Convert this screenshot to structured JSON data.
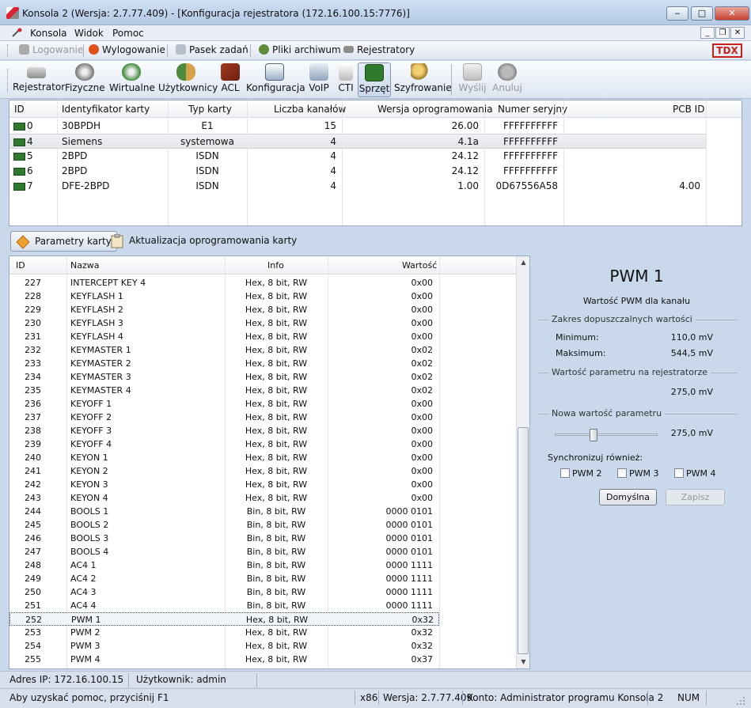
{
  "window": {
    "title": "Konsola 2 (Wersja:  2.7.77.409) - [Konfiguracja rejestratora (172.16.100.15:7776)]"
  },
  "menu": [
    "Konsola",
    "Widok",
    "Pomoc"
  ],
  "quickbar": {
    "login": "Logowanie",
    "logout": "Wylogowanie",
    "taskbar": "Pasek zadań",
    "archives": "Pliki archiwum",
    "recorders": "Rejestratory",
    "brand": "TDX"
  },
  "toolbar": [
    {
      "label": "Rejestrator",
      "icon": "recorder-icon"
    },
    {
      "label": "Fizyczne",
      "icon": "physical-channels-icon"
    },
    {
      "label": "Wirtualne",
      "icon": "virtual-channels-icon"
    },
    {
      "label": "Użytkownicy",
      "icon": "users-icon"
    },
    {
      "label": "ACL",
      "icon": "acl-icon"
    },
    {
      "label": "Konfiguracja",
      "icon": "configuration-icon"
    },
    {
      "label": "VoIP",
      "icon": "voip-icon"
    },
    {
      "label": "CTI",
      "icon": "cti-icon"
    },
    {
      "label": "Sprzęt",
      "icon": "hardware-icon"
    },
    {
      "label": "Szyfrowanie",
      "icon": "encryption-icon"
    },
    {
      "label": "Wyślij",
      "icon": "send-icon"
    },
    {
      "label": "Anuluj",
      "icon": "cancel-icon"
    }
  ],
  "cards": {
    "columns": [
      "ID",
      "Identyfikator karty",
      "Typ karty",
      "Liczba kanałów",
      "Wersja oprogramowania",
      "Numer seryjny",
      "PCB ID"
    ],
    "rows": [
      {
        "id": "0",
        "ident": "30BPDH",
        "type": "E1",
        "channels": "15",
        "version": "26.00",
        "serial": "FFFFFFFFFF",
        "pcb": ""
      },
      {
        "id": "4",
        "ident": "Siemens",
        "type": "systemowa",
        "channels": "4",
        "version": "4.1a",
        "serial": "FFFFFFFFFF",
        "pcb": ""
      },
      {
        "id": "5",
        "ident": "2BPD",
        "type": "ISDN",
        "channels": "4",
        "version": "24.12",
        "serial": "FFFFFFFFFF",
        "pcb": ""
      },
      {
        "id": "6",
        "ident": "2BPD",
        "type": "ISDN",
        "channels": "4",
        "version": "24.12",
        "serial": "FFFFFFFFFF",
        "pcb": ""
      },
      {
        "id": "7",
        "ident": "DFE-2BPD",
        "type": "ISDN",
        "channels": "4",
        "version": "1.00",
        "serial": "0D67556A58",
        "pcb": "4.00"
      }
    ]
  },
  "tabs": [
    "Parametry karty",
    "Aktualizacja oprogramowania karty"
  ],
  "params": {
    "columns": [
      "ID",
      "Nazwa",
      "Info",
      "Wartość"
    ],
    "rows": [
      {
        "id": "227",
        "name": "INTERCEPT KEY 4",
        "info": "Hex, 8 bit, RW",
        "value": "0x00"
      },
      {
        "id": "228",
        "name": "KEYFLASH 1",
        "info": "Hex, 8 bit, RW",
        "value": "0x00"
      },
      {
        "id": "229",
        "name": "KEYFLASH 2",
        "info": "Hex, 8 bit, RW",
        "value": "0x00"
      },
      {
        "id": "230",
        "name": "KEYFLASH 3",
        "info": "Hex, 8 bit, RW",
        "value": "0x00"
      },
      {
        "id": "231",
        "name": "KEYFLASH 4",
        "info": "Hex, 8 bit, RW",
        "value": "0x00"
      },
      {
        "id": "232",
        "name": "KEYMASTER 1",
        "info": "Hex, 8 bit, RW",
        "value": "0x02"
      },
      {
        "id": "233",
        "name": "KEYMASTER 2",
        "info": "Hex, 8 bit, RW",
        "value": "0x02"
      },
      {
        "id": "234",
        "name": "KEYMASTER 3",
        "info": "Hex, 8 bit, RW",
        "value": "0x02"
      },
      {
        "id": "235",
        "name": "KEYMASTER 4",
        "info": "Hex, 8 bit, RW",
        "value": "0x02"
      },
      {
        "id": "236",
        "name": "KEYOFF 1",
        "info": "Hex, 8 bit, RW",
        "value": "0x00"
      },
      {
        "id": "237",
        "name": "KEYOFF 2",
        "info": "Hex, 8 bit, RW",
        "value": "0x00"
      },
      {
        "id": "238",
        "name": "KEYOFF 3",
        "info": "Hex, 8 bit, RW",
        "value": "0x00"
      },
      {
        "id": "239",
        "name": "KEYOFF 4",
        "info": "Hex, 8 bit, RW",
        "value": "0x00"
      },
      {
        "id": "240",
        "name": "KEYON 1",
        "info": "Hex, 8 bit, RW",
        "value": "0x00"
      },
      {
        "id": "241",
        "name": "KEYON 2",
        "info": "Hex, 8 bit, RW",
        "value": "0x00"
      },
      {
        "id": "242",
        "name": "KEYON 3",
        "info": "Hex, 8 bit, RW",
        "value": "0x00"
      },
      {
        "id": "243",
        "name": "KEYON 4",
        "info": "Hex, 8 bit, RW",
        "value": "0x00"
      },
      {
        "id": "244",
        "name": "BOOLS 1",
        "info": "Bin, 8 bit, RW",
        "value": "0000 0101"
      },
      {
        "id": "245",
        "name": "BOOLS 2",
        "info": "Bin, 8 bit, RW",
        "value": "0000 0101"
      },
      {
        "id": "246",
        "name": "BOOLS 3",
        "info": "Bin, 8 bit, RW",
        "value": "0000 0101"
      },
      {
        "id": "247",
        "name": "BOOLS 4",
        "info": "Bin, 8 bit, RW",
        "value": "0000 0101"
      },
      {
        "id": "248",
        "name": "AC4 1",
        "info": "Bin, 8 bit, RW",
        "value": "0000 1111"
      },
      {
        "id": "249",
        "name": "AC4 2",
        "info": "Bin, 8 bit, RW",
        "value": "0000 1111"
      },
      {
        "id": "250",
        "name": "AC4 3",
        "info": "Bin, 8 bit, RW",
        "value": "0000 1111"
      },
      {
        "id": "251",
        "name": "AC4 4",
        "info": "Bin, 8 bit, RW",
        "value": "0000 1111"
      },
      {
        "id": "252",
        "name": "PWM 1",
        "info": "Hex, 8 bit, RW",
        "value": "0x32"
      },
      {
        "id": "253",
        "name": "PWM 2",
        "info": "Hex, 8 bit, RW",
        "value": "0x32"
      },
      {
        "id": "254",
        "name": "PWM 3",
        "info": "Hex, 8 bit, RW",
        "value": "0x32"
      },
      {
        "id": "255",
        "name": "PWM 4",
        "info": "Hex, 8 bit, RW",
        "value": "0x37"
      }
    ],
    "selected_id": "252"
  },
  "detail": {
    "title": "PWM 1",
    "subtitle": "Wartość PWM dla kanału",
    "range_group": "Zakres dopuszczalnych wartości",
    "min_label": "Minimum:",
    "min_value": "110,0 mV",
    "max_label": "Maksimum:",
    "max_value": "544,5 mV",
    "current_group": "Wartość parametru na rejestratorze",
    "current_value": "275,0 mV",
    "new_group": "Nowa wartość parametru",
    "new_value": "275,0 mV",
    "slider_fraction": 0.38,
    "sync_label": "Synchronizuj również:",
    "sync_options": [
      "PWM 2",
      "PWM 3",
      "PWM 4"
    ],
    "default_button": "Domyślna",
    "save_button": "Zapisz"
  },
  "status": {
    "ip": "Adres IP: 172.16.100.15",
    "user": "Użytkownik: admin",
    "help": "Aby uzyskać pomoc, przyciśnij F1",
    "arch": "x86",
    "version": "Wersja: 2.7.77.409",
    "account": "Konto: Administrator programu Konsola 2",
    "num": "NUM"
  },
  "colors": {
    "brand": "#c8201b",
    "selection_row": "#e5e8ec",
    "window_bg": "#c9d8ea"
  }
}
